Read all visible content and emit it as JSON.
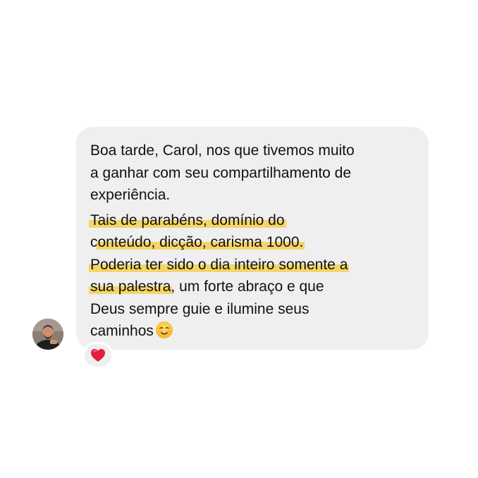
{
  "message": {
    "lines": [
      "Boa tarde, Carol, nos que tivemos muito",
      "a ganhar com seu compartilhamento de",
      "experiência.",
      "Tais de parabéns, domínio do",
      "c",
      "onteúdo, dicção, carisma 1000.",
      "Poderia ter sido o dia inteiro somente a",
      "sua palestra",
      ", um forte abraço e que",
      "Deus sempre guie e ilumine seus",
      "caminhos"
    ],
    "highlight_color": "#f5d567",
    "bubble_color": "#efefef",
    "end_emoji": "smiling-face-icon"
  },
  "reaction": {
    "emoji": "red-heart-icon",
    "color": "#e0245e"
  },
  "sender": {
    "avatar": "profile-photo"
  }
}
